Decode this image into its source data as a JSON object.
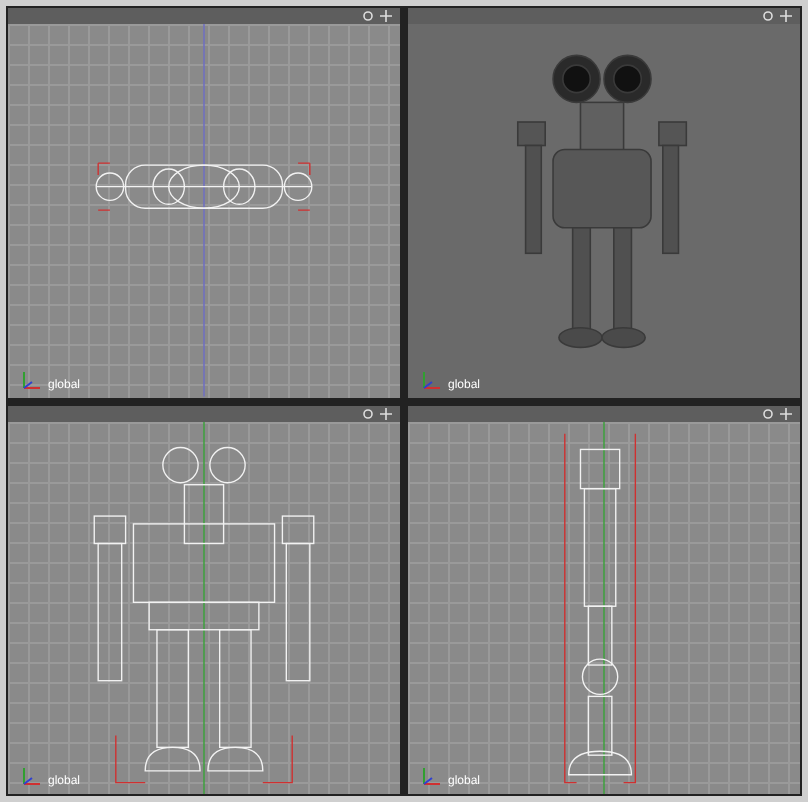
{
  "viewports": [
    {
      "kind": "top",
      "shaded": false,
      "axis_label": "global"
    },
    {
      "kind": "perspective",
      "shaded": true,
      "axis_label": "global"
    },
    {
      "kind": "front",
      "shaded": false,
      "axis_label": "global"
    },
    {
      "kind": "side",
      "shaded": false,
      "axis_label": "global"
    }
  ]
}
